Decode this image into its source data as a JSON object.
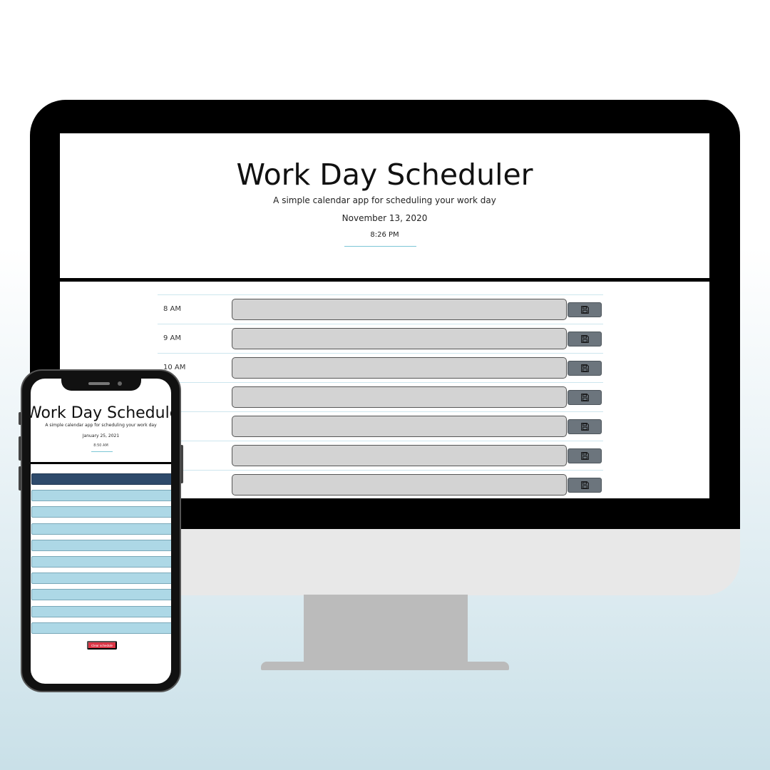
{
  "desktop": {
    "title": "Work Day Scheduler",
    "subtitle": "A simple calendar app for scheduling your work day",
    "date": "November 13, 2020",
    "time": "8:26 PM",
    "hours": [
      "8 AM",
      "9 AM",
      "10 AM",
      "",
      "",
      "",
      ""
    ],
    "save_icon": "floppy-disk-icon"
  },
  "mobile": {
    "title": "Work Day Schedule",
    "subtitle": "A simple calendar app for scheduling your work day",
    "date": "January 25, 2021",
    "time": "8:50 AM",
    "clear_label": "Clear schedule",
    "slot_states": [
      "present",
      "future",
      "future",
      "future",
      "future",
      "future",
      "future",
      "future",
      "future",
      "future"
    ]
  },
  "colors": {
    "past_input": "#d3d3d3",
    "present": "#2e4a6b",
    "future": "#add8e6",
    "save_button": "#6c757d",
    "clear_button": "#dc3545"
  }
}
